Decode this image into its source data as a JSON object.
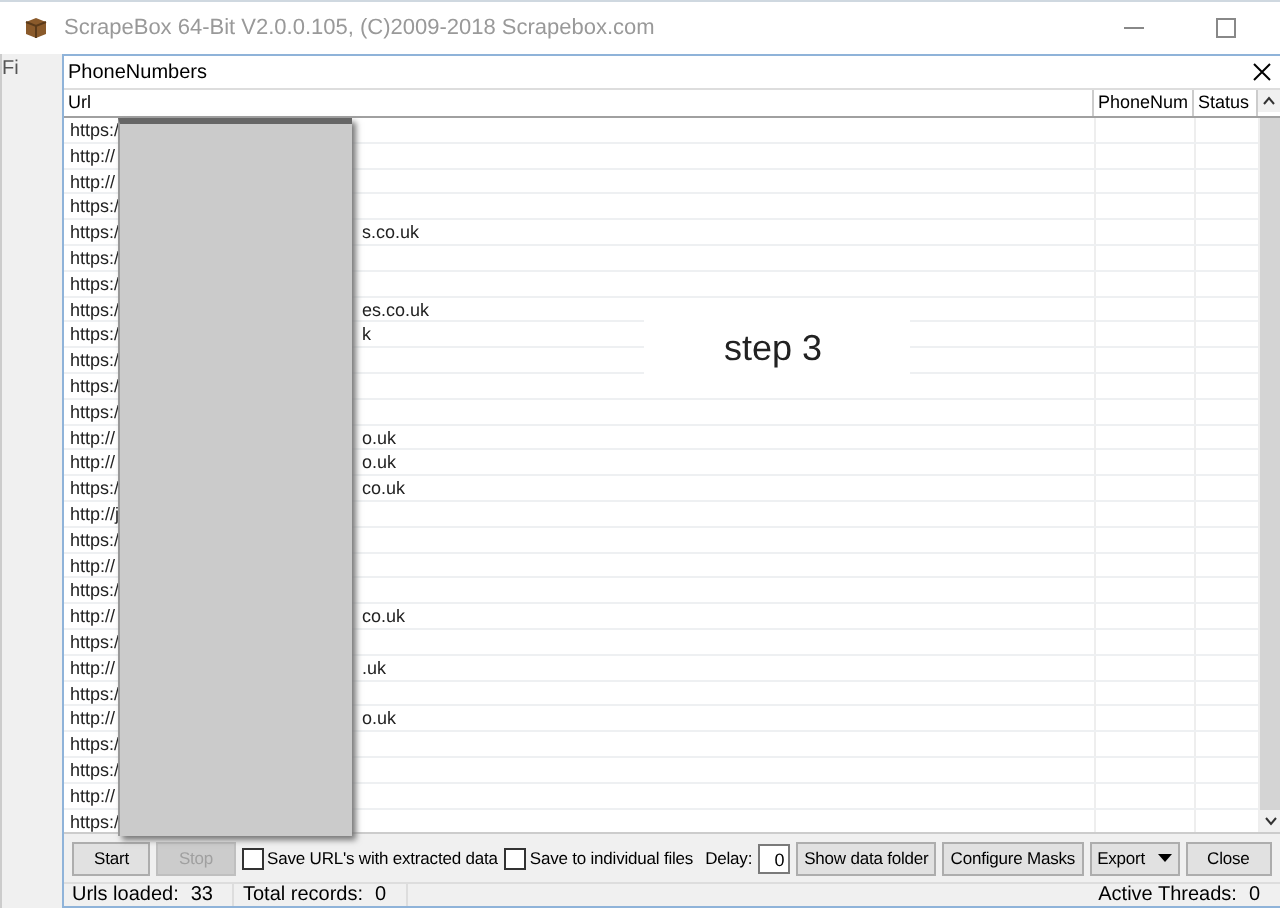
{
  "app_window": {
    "title": "ScrapeBox 64-Bit V2.0.0.105, (C)2009-2018 Scrapebox.com",
    "menu_fragment": "Fi"
  },
  "dialog": {
    "title": "PhoneNumbers"
  },
  "table": {
    "columns": [
      "Url",
      "PhoneNum",
      "Status"
    ],
    "rows": [
      {
        "url_start": "https:/"
      },
      {
        "url_start": "http://"
      },
      {
        "url_start": "http://"
      },
      {
        "url_start": "https:/"
      },
      {
        "url_start": "https:/",
        "url_end": "s.co.uk"
      },
      {
        "url_start": "https:/"
      },
      {
        "url_start": "https:/"
      },
      {
        "url_start": "https:/",
        "url_end": "es.co.uk"
      },
      {
        "url_start": "https:/",
        "url_end": "k"
      },
      {
        "url_start": "https:/"
      },
      {
        "url_start": "https:/"
      },
      {
        "url_start": "https:/"
      },
      {
        "url_start": "http://",
        "url_end": "o.uk"
      },
      {
        "url_start": "http://",
        "url_end": "o.uk"
      },
      {
        "url_start": "https:/",
        "url_end": "co.uk"
      },
      {
        "url_start": "http://j"
      },
      {
        "url_start": "https:/"
      },
      {
        "url_start": "http://"
      },
      {
        "url_start": "https:/"
      },
      {
        "url_start": "http://",
        "url_end": "co.uk"
      },
      {
        "url_start": "https:/"
      },
      {
        "url_start": "http://",
        "url_end": ".uk"
      },
      {
        "url_start": "https:/"
      },
      {
        "url_start": "http://",
        "url_end": "o.uk"
      },
      {
        "url_start": "https:/"
      },
      {
        "url_start": "https:/"
      },
      {
        "url_start": "http://"
      },
      {
        "url_start": "https:/"
      }
    ]
  },
  "overlay_note": "step 3",
  "toolbar": [
    {
      "kind": "button",
      "label": "Start",
      "disabled": false
    },
    {
      "kind": "button",
      "label": "Stop",
      "disabled": true
    },
    {
      "kind": "checkbox",
      "label": "Save URL's with extracted data",
      "checked": false
    },
    {
      "kind": "checkbox",
      "label": "Save to individual files",
      "checked": false
    },
    {
      "kind": "field",
      "label": "Delay:",
      "value": "0"
    },
    {
      "kind": "button",
      "label": "Show data folder",
      "disabled": false
    },
    {
      "kind": "button",
      "label": "Configure Masks",
      "disabled": false
    },
    {
      "kind": "menu-button",
      "label": "Export",
      "disabled": false
    },
    {
      "kind": "button",
      "label": "Close",
      "disabled": false
    }
  ],
  "status_bar": [
    {
      "label": "Urls loaded:",
      "value": "33"
    },
    {
      "label": "Total records:",
      "value": "0"
    },
    {
      "label": "Active Threads:",
      "value": "0"
    }
  ]
}
